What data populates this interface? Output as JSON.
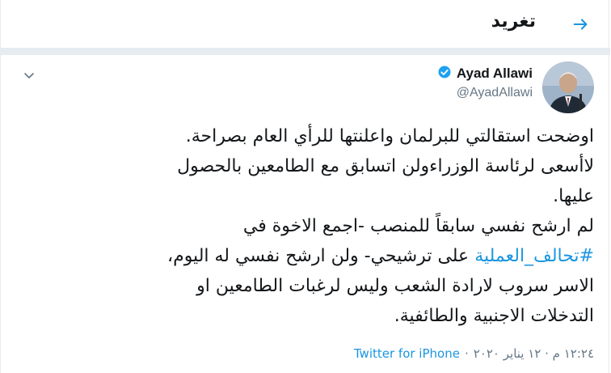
{
  "header": {
    "title": "تغريد",
    "back_icon": "arrow-right-icon"
  },
  "tweet": {
    "author_name": "Ayad Allawi",
    "author_handle": "@AyadAllawi",
    "verified_icon": "verified-badge-icon",
    "menu_icon": "chevron-down-icon",
    "lines": [
      "اوضحت استقالتي للبرلمان واعلنتها للرأي العام بصراحة.",
      "لاأسعى لرئاسة الوزراءولن اتسابق مع الطامعين بالحصول",
      "عليها.",
      "لم ارشح نفسي سابقاً للمنصب -اجمع الاخوة في"
    ],
    "line5_hashtag": "#تحالف_العملية",
    "line5_rest": "على ترشيحي- ولن ارشح نفسي له اليوم،",
    "line6": "الاسر سروب لارادة الشعب وليس لرغبات الطامعين او",
    "line7": "التدخلات الاجنبية والطائفية.",
    "timestamp": "١٢:٢٤ م · ١٢ يناير ٢٠٢٠",
    "separator": "·",
    "source": "Twitter for iPhone"
  },
  "colors": {
    "accent": "#1b95e0",
    "text": "#14171a",
    "muted": "#657786",
    "border": "#e6ecf0"
  }
}
